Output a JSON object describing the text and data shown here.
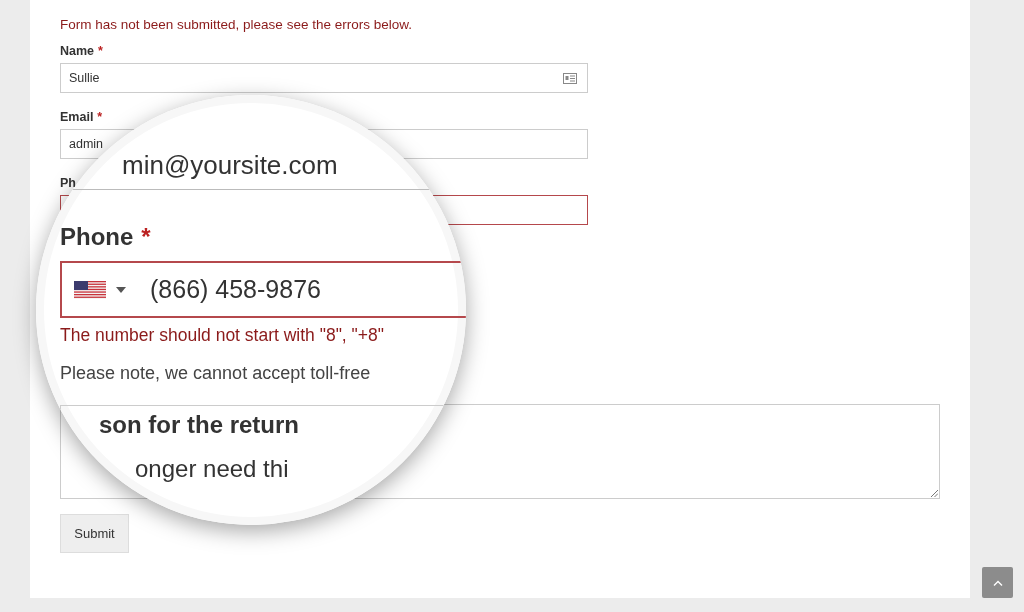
{
  "notice": "Form has not been submitted, please see the errors below.",
  "fields": [
    {
      "kind": "text",
      "label": "Name",
      "mark": "*",
      "value": "Sullie",
      "invalid": false
    },
    {
      "kind": "email",
      "label": "Email",
      "mark": "*",
      "value": "admin",
      "invalid": false
    },
    {
      "kind": "phone",
      "label": "Ph",
      "invalid": true
    }
  ],
  "submit": "Submit",
  "magnifier": {
    "email_value": "min@yoursite.com",
    "phone_label": "Phone",
    "phone_mark": "*",
    "phone_value": "(866) 458-9876",
    "phone_invalid": true,
    "error": "The number should not start with \"8\", \"+8\"",
    "note": "Please note, we cannot accept toll-free",
    "textarea_label": "son for the return",
    "textarea_value": "onger need thi"
  }
}
